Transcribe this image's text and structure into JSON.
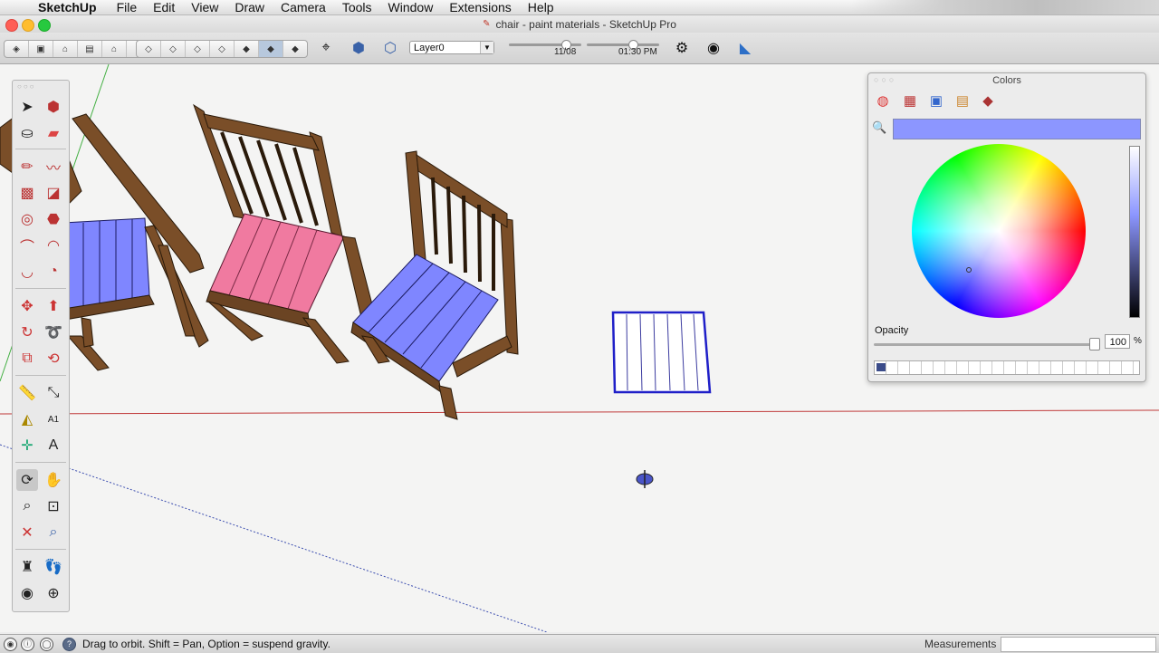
{
  "menubar": {
    "app_name": "SketchUp",
    "items": [
      "File",
      "Edit",
      "View",
      "Draw",
      "Camera",
      "Tools",
      "Window",
      "Extensions",
      "Help"
    ]
  },
  "window": {
    "title": "chair - paint materials - SketchUp Pro"
  },
  "toolbar": {
    "layer": "Layer0",
    "shadow_date": "11/08",
    "shadow_time": "01:30 PM",
    "view_buttons": [
      "iso-view-icon",
      "top-view-icon",
      "front-view-icon",
      "right-view-icon",
      "back-view-icon",
      "left-view-icon"
    ],
    "style_buttons": [
      "xray-icon",
      "back-edges-icon",
      "wireframe-icon",
      "hidden-line-icon",
      "shaded-icon",
      "shaded-textures-icon",
      "monochrome-icon"
    ]
  },
  "colors_panel": {
    "title": "Colors",
    "current_color": "#8c96ff",
    "opacity_label": "Opacity",
    "opacity_value": "100",
    "opacity_unit": "%"
  },
  "status": {
    "message": "Drag to orbit. Shift = Pan, Option = suspend gravity.",
    "measurements_label": "Measurements",
    "measurements_value": ""
  },
  "scene": {
    "chair_wood_color": "#7a4e28",
    "seat_blue": "#7f86ff",
    "seat_pink": "#f07aa0"
  }
}
